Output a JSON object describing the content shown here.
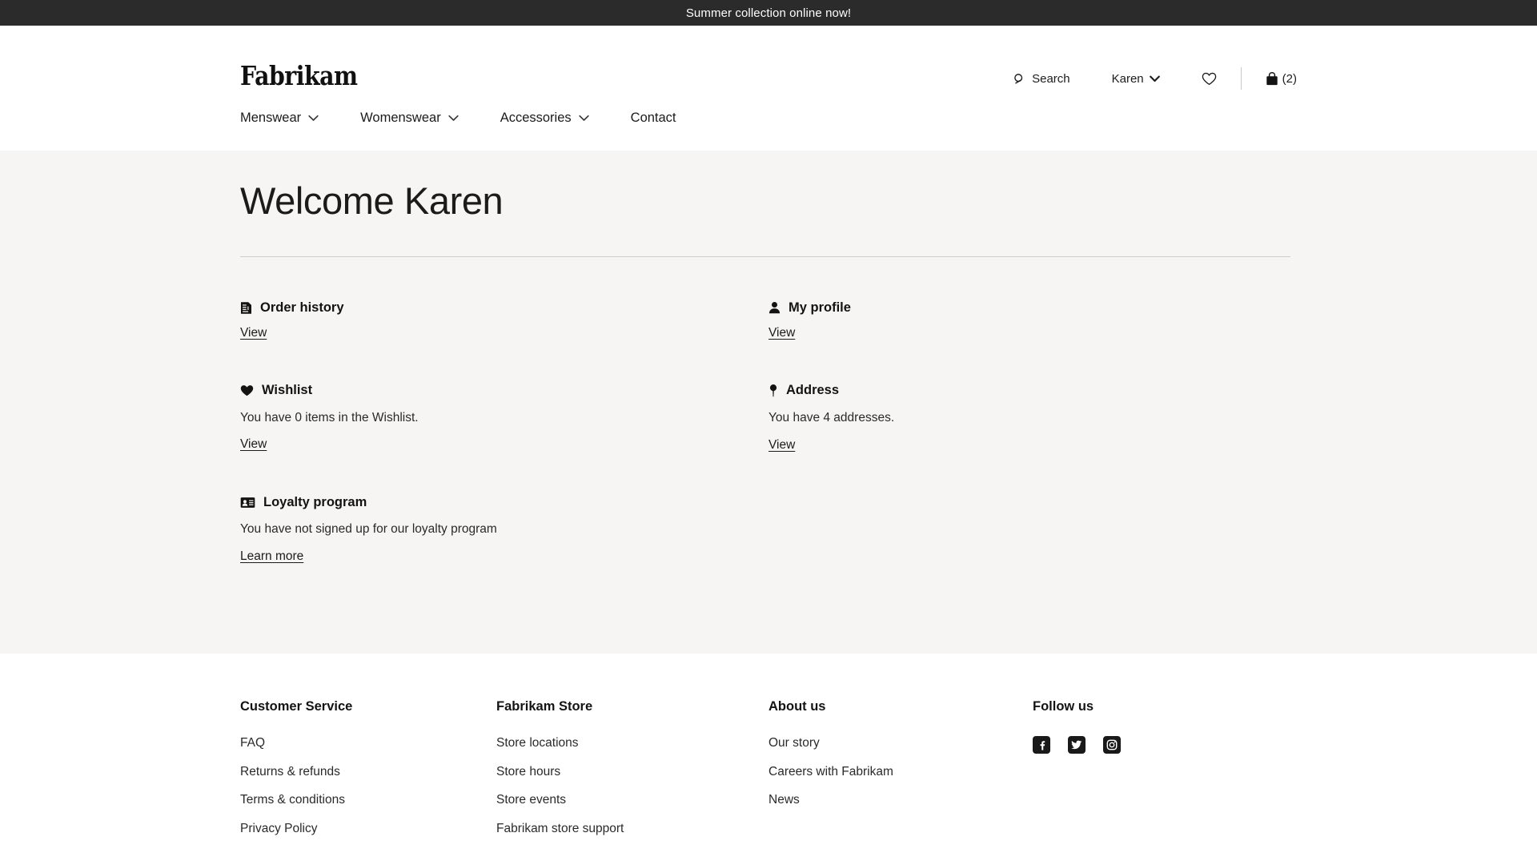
{
  "promo": {
    "message": "Summer collection online now!",
    "background": "#2b2b2b",
    "text_color": "#ffffff"
  },
  "header": {
    "brand": "Fabrikam",
    "search_label": "Search",
    "search_icon": "search-icon",
    "account_name": "Karen",
    "account_chevron": "chevron-down-icon",
    "wishlist_icon": "heart-outline-icon",
    "bag_icon": "shopping-bag-icon",
    "bag_count": "(2)"
  },
  "nav": {
    "items": [
      {
        "label": "Menswear",
        "has_dropdown": true,
        "icon": "chevron-down-icon"
      },
      {
        "label": "Womenswear",
        "has_dropdown": true,
        "icon": "chevron-down-icon"
      },
      {
        "label": "Accessories",
        "has_dropdown": true,
        "icon": "chevron-down-icon"
      },
      {
        "label": "Contact",
        "has_dropdown": false,
        "icon": ""
      }
    ]
  },
  "main": {
    "title": "Welcome Karen",
    "background": "#f6f5f3",
    "cards": [
      {
        "title": "Order history",
        "icon": "receipt-document-icon",
        "description": "",
        "link": "View"
      },
      {
        "title": "My profile",
        "icon": "person-icon",
        "description": "",
        "link": "View"
      },
      {
        "title": "Wishlist",
        "icon": "heart-filled-icon",
        "description": "You have 0 items in the Wishlist.",
        "link": "View"
      },
      {
        "title": "Address",
        "icon": "map-pin-icon",
        "description": "You have 4 addresses.",
        "link": "View"
      },
      {
        "title": "Loyalty program",
        "icon": "id-card-icon",
        "description": "You have not signed up for our loyalty program",
        "link": "Learn more"
      }
    ]
  },
  "footer": {
    "columns": [
      {
        "heading": "Customer Service",
        "links": [
          "FAQ",
          "Returns & refunds",
          "Terms & conditions",
          "Privacy Policy"
        ]
      },
      {
        "heading": "Fabrikam Store",
        "links": [
          "Store locations",
          "Store hours",
          "Store events",
          "Fabrikam store support"
        ]
      },
      {
        "heading": "About us",
        "links": [
          "Our story",
          "Careers with Fabrikam",
          "News"
        ]
      }
    ],
    "social": {
      "heading": "Follow us",
      "icons": [
        "facebook-icon",
        "twitter-icon",
        "instagram-icon"
      ]
    }
  }
}
